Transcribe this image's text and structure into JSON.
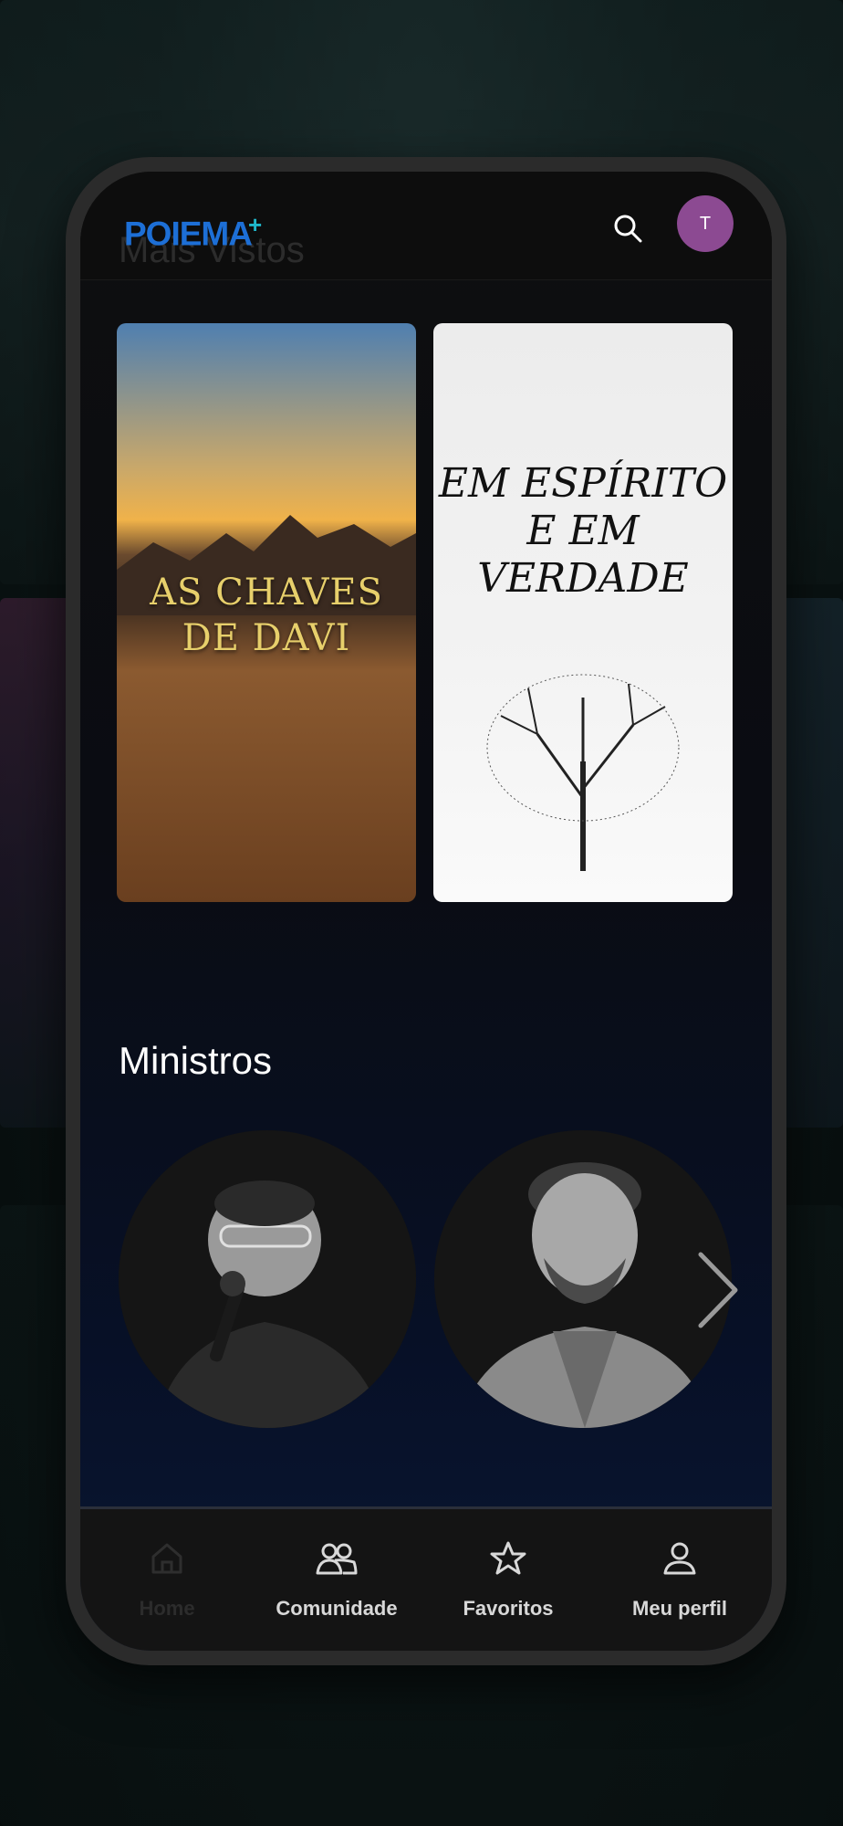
{
  "app": {
    "logo_text": "POIEMA",
    "logo_plus": "+",
    "faded_heading": "Mais Vistos",
    "avatar_initial": "T",
    "brand_color": "#1d6fd6",
    "avatar_color": "#8c4a92"
  },
  "featured": [
    {
      "title": "AS CHAVES DE DAVI"
    },
    {
      "title": "EM ESPÍRITO E EM VERDADE"
    }
  ],
  "ministers": {
    "title": "Ministros"
  },
  "bottom_nav": {
    "items": [
      {
        "label": "Home",
        "icon": "home-icon",
        "active": true
      },
      {
        "label": "Comunidade",
        "icon": "community-icon",
        "active": false
      },
      {
        "label": "Favoritos",
        "icon": "star-icon",
        "active": false
      },
      {
        "label": "Meu perfil",
        "icon": "user-icon",
        "active": false
      }
    ]
  }
}
